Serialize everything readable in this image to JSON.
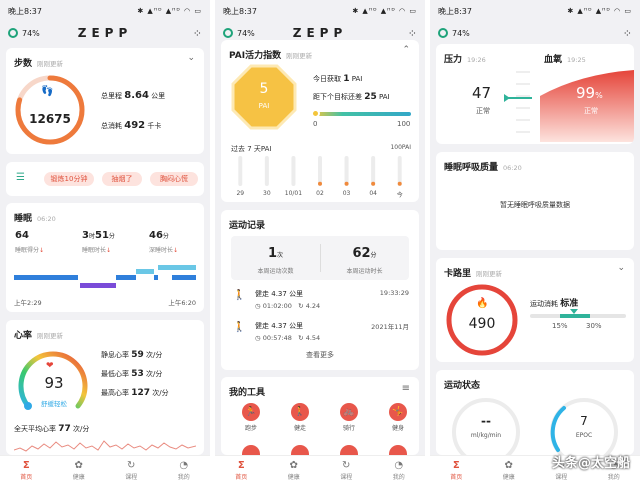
{
  "status": {
    "time": "晚上8:37",
    "icons": "✱ ▲ᴴᴰ ▲ᴴᴰ ◠ ▭"
  },
  "header": {
    "battery": "74%",
    "logo": "ZEPP"
  },
  "tabs": [
    {
      "label": "首页"
    },
    {
      "label": "健康"
    },
    {
      "label": "课程"
    },
    {
      "label": "我的"
    }
  ],
  "steps": {
    "title": "步数",
    "updated": "刚刚更新",
    "count": "12675",
    "distance_label": "总里程",
    "distance": "8.64",
    "distance_unit": "公里",
    "calorie_label": "总消耗",
    "calorie": "492",
    "calorie_unit": "千卡",
    "progress": 0.8
  },
  "tags": [
    "锻炼10分钟",
    "抽烟了",
    "胸闷心慌"
  ],
  "sleep": {
    "title": "睡眠",
    "time": "06:20",
    "score": "64",
    "score_label": "睡眠得分",
    "dur_h": "3",
    "dur_h_unit": "时",
    "dur_m": "51",
    "dur_m_unit": "分",
    "dur_label": "睡眠时长",
    "deep": "46",
    "deep_unit": "分",
    "deep_label": "深睡时长",
    "start": "上午2:29",
    "end": "上午6:20"
  },
  "hr": {
    "title": "心率",
    "updated": "刚刚更新",
    "value": "93",
    "state": "舒缓轻松",
    "rest_label": "静息心率",
    "rest": "59",
    "min_label": "最低心率",
    "min": "53",
    "max_label": "最高心率",
    "max": "127",
    "unit": "次/分",
    "avg_label": "全天平均心率",
    "avg": "77",
    "avg_unit": "次/分"
  },
  "pai": {
    "title": "PAI活力指数",
    "updated": "刚刚更新",
    "value": "5",
    "value_label": "PAI",
    "today_label": "今日获取",
    "today": "1",
    "today_unit": "PAI",
    "goal_label": "距下个目标还差",
    "goal": "25",
    "goal_unit": "PAI",
    "bar_min": "0",
    "bar_max": "100",
    "week_label": "过去 7 天PAI",
    "week_max": "100PAI",
    "week_days": [
      "29",
      "30",
      "10/01",
      "02",
      "03",
      "04",
      "今"
    ],
    "week_values": [
      0,
      0,
      0,
      1,
      1,
      1,
      1
    ]
  },
  "workouts": {
    "title": "运动记录",
    "count": "1",
    "count_unit": "次",
    "count_label": "本周运动次数",
    "dur": "62",
    "dur_unit": "分",
    "dur_label": "本周运动时长",
    "items": [
      {
        "name": "健走",
        "dist": "4.37",
        "unit": "公里",
        "date": "19:33:29",
        "time": "01:02:00",
        "pace": "4.24"
      },
      {
        "name": "健走",
        "dist": "4.37",
        "unit": "公里",
        "date": "2021年11月",
        "time": "00:57:48",
        "pace": "4.54"
      }
    ],
    "more": "查看更多"
  },
  "tools": {
    "title": "我的工具",
    "items": [
      {
        "label": "跑步",
        "icon": "run-icon"
      },
      {
        "label": "健走",
        "icon": "walk-icon"
      },
      {
        "label": "骑行",
        "icon": "bike-icon"
      },
      {
        "label": "健身",
        "icon": "fitness-icon"
      }
    ]
  },
  "stress": {
    "title": "压力",
    "time": "19:26",
    "value": "47",
    "state": "正常"
  },
  "spo2": {
    "title": "血氧",
    "time": "19:25",
    "value": "99",
    "unit": "%",
    "state": "正常"
  },
  "breath": {
    "title": "睡眠呼吸质量",
    "time": "06:20",
    "empty": "暂无睡眠呼吸质量数据"
  },
  "calorie": {
    "title": "卡路里",
    "updated": "刚刚更新",
    "value": "490",
    "label": "运动消耗",
    "level": "标准",
    "low": "15%",
    "high": "30%"
  },
  "sport": {
    "title": "运动状态",
    "vo2": "--",
    "vo2_unit": "ml/kg/min",
    "epoc": "7",
    "epoc_label": "EPOC"
  },
  "watermark": "头条@太空船"
}
